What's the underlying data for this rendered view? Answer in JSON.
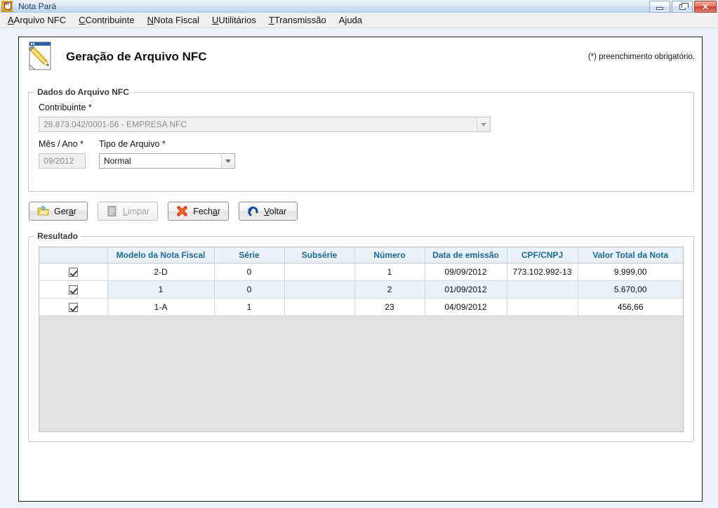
{
  "window": {
    "title": "Nota Pará",
    "app_icon": "coat-of-arms-icon",
    "minimize_label": "–",
    "restore_label": "□",
    "close_label": "✕"
  },
  "menubar": {
    "items": [
      {
        "label": "Arquivo NFC",
        "mnemonic": "A"
      },
      {
        "label": "Contribuinte",
        "mnemonic": "C"
      },
      {
        "label": "Nota Fiscal",
        "mnemonic": "N"
      },
      {
        "label": "Utilitários",
        "mnemonic": "U"
      },
      {
        "label": "Transmissão",
        "mnemonic": "T"
      },
      {
        "label": "Ajuda",
        "mnemonic": ""
      }
    ]
  },
  "header": {
    "icon": "pencil-document-icon",
    "title": "Geração de Arquivo NFC",
    "required_note": "(*) preenchimento obrigatório."
  },
  "form": {
    "legend": "Dados do Arquivo NFC",
    "contribuinte": {
      "label": "Contribuinte *",
      "value": "28.873.042/0001-56 - EMPRESA NFC",
      "placeholder": "",
      "disabled": true
    },
    "mes_ano": {
      "label": "Mês / Ano *",
      "value": "09/2012",
      "placeholder": "",
      "disabled": true
    },
    "tipo_arquivo": {
      "label": "Tipo de Arquivo *",
      "value": "Normal",
      "options": [
        "Normal"
      ],
      "disabled": false
    }
  },
  "buttons": [
    {
      "id": "gerar",
      "label": "Ger",
      "mnemonic": "a",
      "suffix": "r",
      "icon": "open-folder-icon",
      "disabled": false
    },
    {
      "id": "limpar",
      "label": "",
      "mnemonic": "L",
      "suffix": "impar",
      "icon": "document-lines-icon",
      "disabled": true
    },
    {
      "id": "fechar",
      "label": "Fech",
      "mnemonic": "a",
      "suffix": "r",
      "icon": "red-x-icon",
      "disabled": false
    },
    {
      "id": "voltar",
      "label": "",
      "mnemonic": "V",
      "suffix": "oltar",
      "icon": "undo-arrow-icon",
      "disabled": false
    }
  ],
  "result": {
    "legend": "Resultado",
    "columns": [
      "",
      "Modelo da Nota Fiscal",
      "Série",
      "Subsérie",
      "Número",
      "Data de emissão",
      "CPF/CNPJ",
      "Valor Total da Nota"
    ],
    "rows": [
      {
        "checked": true,
        "selected": false,
        "modelo": "2-D",
        "serie": "0",
        "subserie": "",
        "numero": "1",
        "data_emissao": "09/09/2012",
        "cpf_cnpj": "773.102.992-13",
        "valor_total": "9.999,00"
      },
      {
        "checked": true,
        "selected": true,
        "modelo": "1",
        "serie": "0",
        "subserie": "",
        "numero": "2",
        "data_emissao": "01/09/2012",
        "cpf_cnpj": "",
        "valor_total": "5.670,00"
      },
      {
        "checked": true,
        "selected": false,
        "modelo": "1-A",
        "serie": "1",
        "subserie": "",
        "numero": "23",
        "data_emissao": "04/09/2012",
        "cpf_cnpj": "",
        "valor_total": "456,66"
      }
    ]
  },
  "colors": {
    "header_text": "#1b6a97",
    "header_bg": "#eaf1f9",
    "selected_row": "#e8f0fa",
    "panel_bg": "#ffffff",
    "desktop_bg": "#eef2f8"
  }
}
